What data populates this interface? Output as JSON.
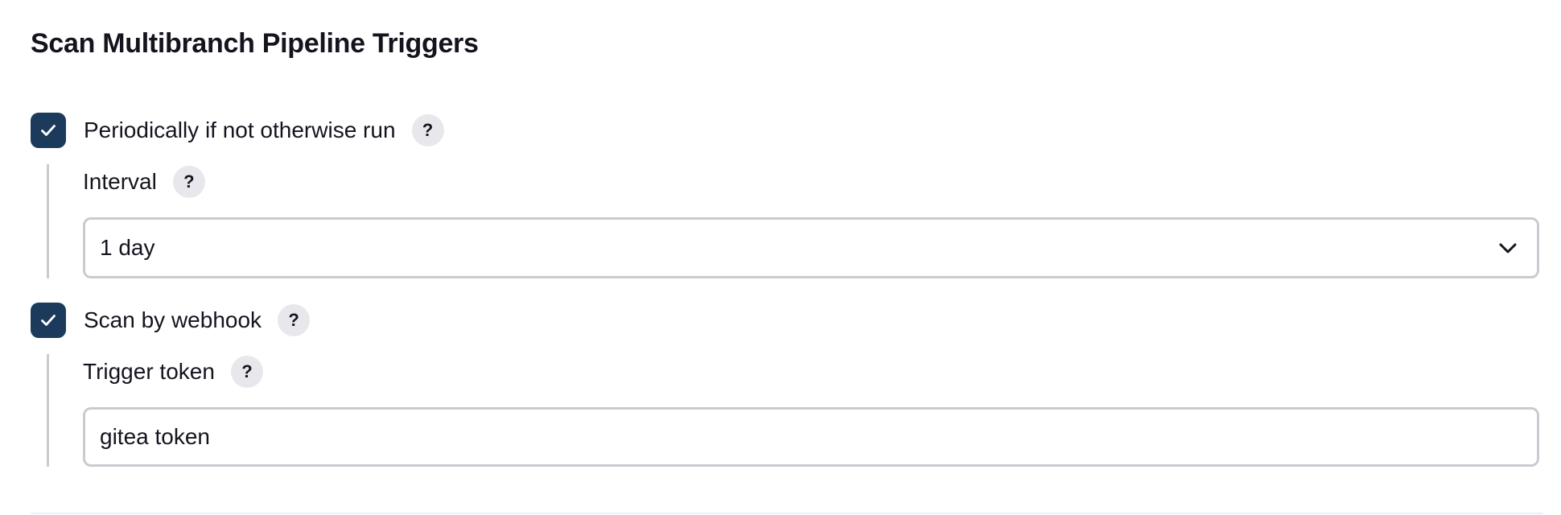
{
  "section": {
    "title": "Scan Multibranch Pipeline Triggers"
  },
  "periodic": {
    "label": "Periodically if not otherwise run",
    "checked": true,
    "help": "?",
    "interval": {
      "label": "Interval",
      "help": "?",
      "value": "1 day"
    }
  },
  "webhook": {
    "label": "Scan by webhook",
    "checked": true,
    "help": "?",
    "token": {
      "label": "Trigger token",
      "help": "?",
      "value": "gitea token"
    }
  },
  "colors": {
    "checkbox": "#1b3a5c",
    "help_bg": "#e8e8ec",
    "border": "#c8ccd1",
    "text": "#14141f"
  },
  "icons": {
    "checkbox": "checkmark-icon",
    "select": "chevron-down-icon"
  }
}
